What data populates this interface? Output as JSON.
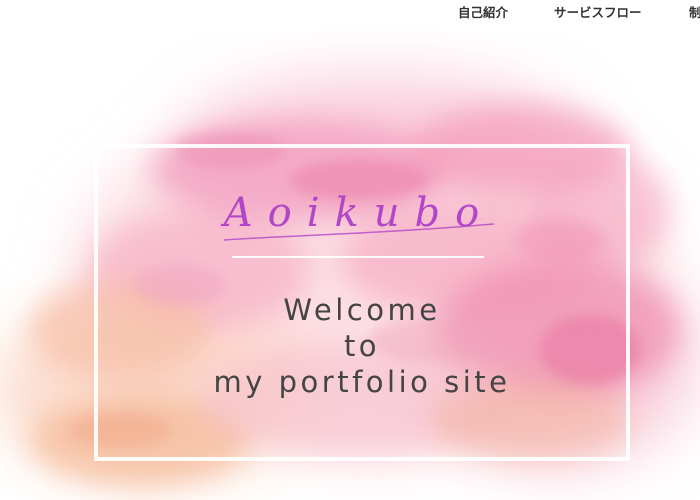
{
  "nav": {
    "items": [
      {
        "label": "自己紹介"
      },
      {
        "label": "サービスフロー"
      },
      {
        "label": "制"
      }
    ]
  },
  "hero": {
    "logo_text": "Aoikubo",
    "logo_color": "#b246c8",
    "welcome_lines": [
      "Welcome",
      "to",
      "my portfolio site"
    ],
    "text_color": "#444444",
    "background": "pink and orange watercolor splash"
  }
}
